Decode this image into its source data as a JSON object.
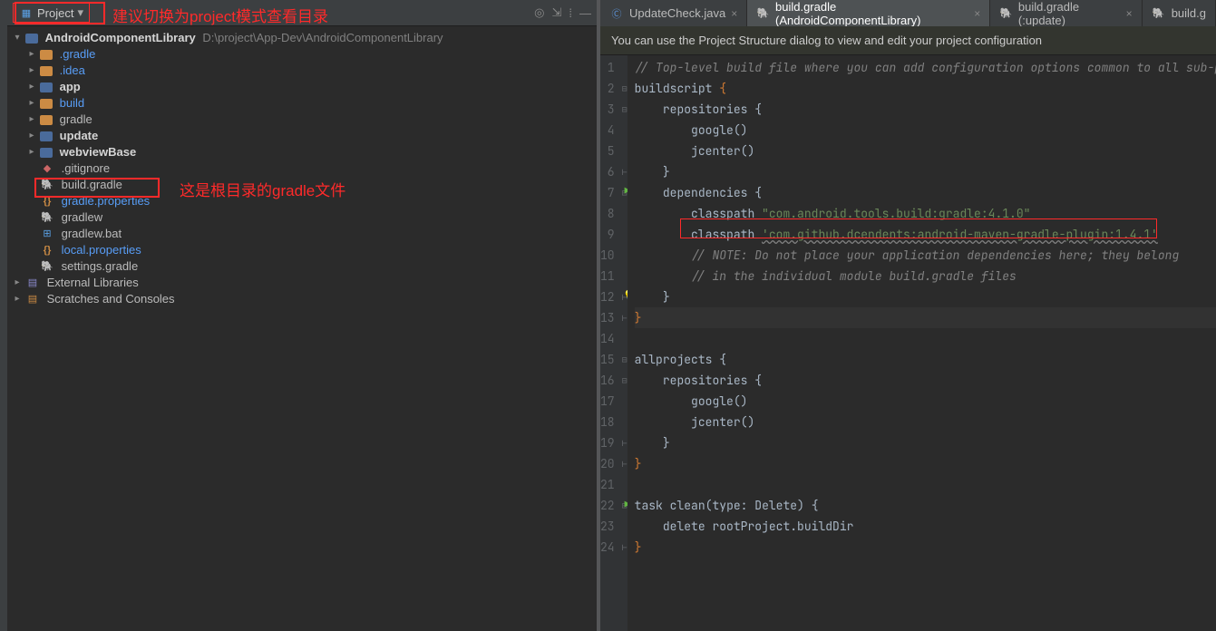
{
  "sidebar": {
    "project_selector": "Project",
    "root": {
      "name": "AndroidComponentLibrary",
      "path": "D:\\project\\App-Dev\\AndroidComponentLibrary"
    },
    "children": [
      {
        "name": ".gradle",
        "type": "folder",
        "light": true
      },
      {
        "name": ".idea",
        "type": "folder",
        "light": true
      },
      {
        "name": "app",
        "type": "folder",
        "bold": true
      },
      {
        "name": "build",
        "type": "folder",
        "light": true
      },
      {
        "name": "gradle",
        "type": "folder"
      },
      {
        "name": "update",
        "type": "folder",
        "bold": true
      },
      {
        "name": "webviewBase",
        "type": "folder",
        "bold": true
      }
    ],
    "files": [
      {
        "name": ".gitignore",
        "icon": "gear"
      },
      {
        "name": "build.gradle",
        "icon": "elephant"
      },
      {
        "name": "gradle.properties",
        "icon": "brace",
        "light": true
      },
      {
        "name": "gradlew",
        "icon": "elephant"
      },
      {
        "name": "gradlew.bat",
        "icon": "win"
      },
      {
        "name": "local.properties",
        "icon": "brace",
        "light": true
      },
      {
        "name": "settings.gradle",
        "icon": "elephant"
      }
    ],
    "ext_lib": "External Libraries",
    "scratches": "Scratches and Consoles"
  },
  "annotations": {
    "a1": "建议切换为project模式查看目录",
    "a2": "这是根目录的gradle文件"
  },
  "tabs": [
    {
      "label": "UpdateCheck.java",
      "active": false,
      "icon": "class"
    },
    {
      "label": "build.gradle (AndroidComponentLibrary)",
      "active": true,
      "icon": "elephant"
    },
    {
      "label": "build.gradle (:update)",
      "active": false,
      "icon": "elephant"
    },
    {
      "label": "build.g",
      "active": false,
      "icon": "elephant"
    }
  ],
  "notice": "You can use the Project Structure dialog to view and edit your project configuration",
  "code": {
    "l1": "// Top-level build file where you can add configuration options common to all sub-project",
    "l2a": "buildscript ",
    "l2b": "{",
    "l3a": "    repositories ",
    "l3b": "{",
    "l4": "        google()",
    "l5": "        jcenter()",
    "l6": "    }",
    "l7a": "    dependencies ",
    "l7b": "{",
    "l8a": "        classpath ",
    "l8b": "\"com.android.tools.build:gradle:4.1.0\"",
    "l9a": "        classpath ",
    "l9b": "'com.github.dcendents:android-maven-gradle-plugin:1.4.1'",
    "l10": "        // NOTE: Do not place your application dependencies here; they belong",
    "l11": "        // in the individual module build.gradle files",
    "l12": "    }",
    "l13": "}",
    "l15a": "allprojects ",
    "l15b": "{",
    "l16a": "    repositories ",
    "l16b": "{",
    "l17": "        google()",
    "l18": "        jcenter()",
    "l19": "    }",
    "l20": "}",
    "l22a": "task ",
    "l22b": "clean",
    "l22c": "(type: Delete) ",
    "l22d": "{",
    "l23": "    delete rootProject.buildDir",
    "l24": "}"
  }
}
